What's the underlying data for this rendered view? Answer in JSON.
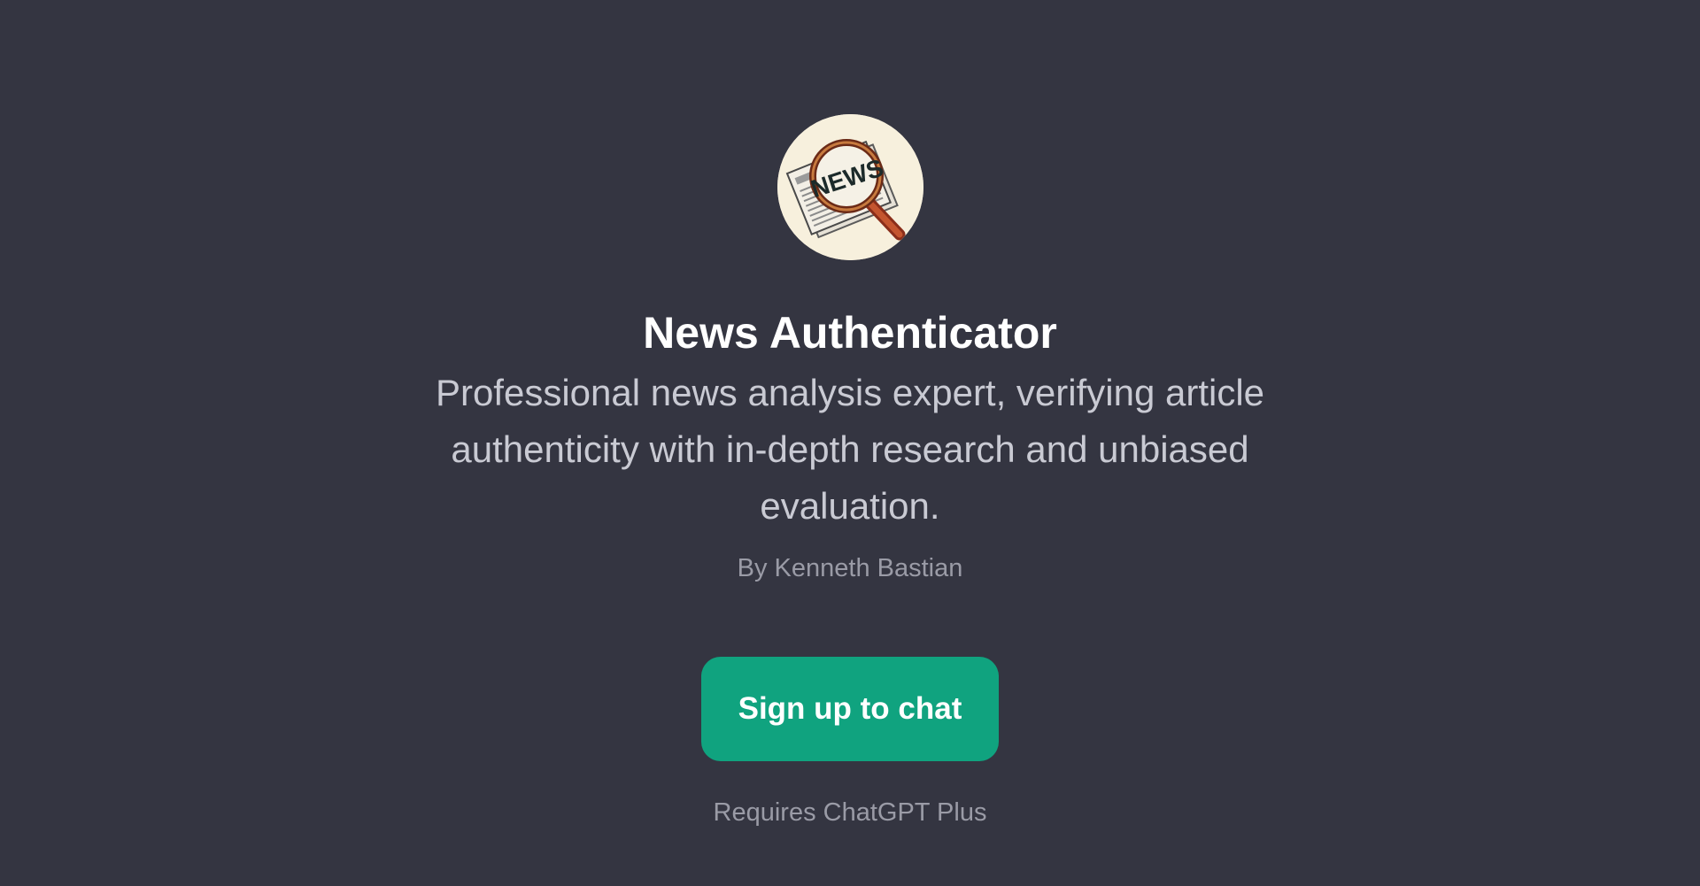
{
  "gpt": {
    "avatar_icon": "newspaper-magnifying-glass-icon",
    "avatar_text": "NEWS",
    "title": "News Authenticator",
    "description": "Professional news analysis expert, verifying article authenticity with in-depth research and unbiased evaluation.",
    "author": "By Kenneth Bastian"
  },
  "cta": {
    "signup_label": "Sign up to chat",
    "requirement": "Requires ChatGPT Plus"
  },
  "colors": {
    "background": "#343541",
    "accent": "#10a37f",
    "title": "#ffffff",
    "description": "#c9cad3",
    "muted": "#9a9ba6"
  }
}
